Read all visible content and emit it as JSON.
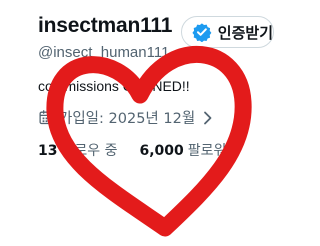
{
  "profile": {
    "display_name": "insectman111",
    "handle": "@insect_human111",
    "bio": "commissions OPENED!!",
    "joined": "가입일: 2025년 12월"
  },
  "verify_button": {
    "label": "인증받기",
    "accent": "#1d9bf0"
  },
  "stats": {
    "following_count": "13",
    "following_label": "팔로우 중",
    "followers_count": "6,000",
    "followers_label": "팔로워"
  },
  "overlay": {
    "shape": "heart",
    "color": "#e31b1b"
  },
  "icons": {
    "verify": "verified-badge-icon",
    "calendar": "calendar-icon",
    "chevron": "chevron-right-icon"
  }
}
